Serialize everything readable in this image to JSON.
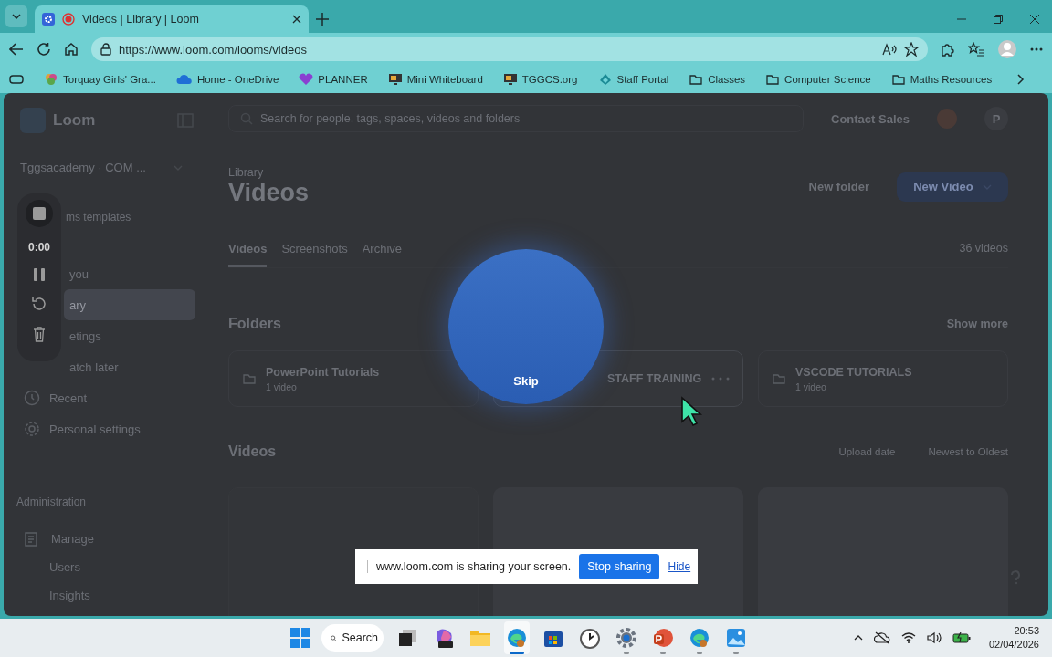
{
  "browser": {
    "tabs": [
      {
        "title": "Videos | Library | Loom",
        "selected": true
      }
    ],
    "url": "https://www.loom.com/looms/videos",
    "bookmarks": [
      {
        "label": "Torquay Girls' Gra...",
        "kind": "site"
      },
      {
        "label": "Home - OneDrive",
        "kind": "cloud"
      },
      {
        "label": "PLANNER",
        "kind": "planner"
      },
      {
        "label": "Mini Whiteboard",
        "kind": "screen"
      },
      {
        "label": "TGGCS.org",
        "kind": "screen"
      },
      {
        "label": "Staff Portal",
        "kind": "portal"
      },
      {
        "label": "Classes",
        "kind": "folder"
      },
      {
        "label": "Computer Science",
        "kind": "folder"
      },
      {
        "label": "Maths Resources",
        "kind": "folder"
      }
    ]
  },
  "sidebar": {
    "logo": "Loom",
    "workspace": "Tggsacademy · COM ...",
    "templates": "ms templates",
    "items": [
      {
        "label": "you",
        "kind": "clipped",
        "selected": false
      },
      {
        "label": "ary",
        "kind": "clipped",
        "selected": true
      },
      {
        "label": "etings",
        "kind": "clipped",
        "selected": false
      },
      {
        "label": "atch later",
        "kind": "clipped",
        "selected": false
      },
      {
        "label": "Recent",
        "kind": "recent",
        "selected": false
      },
      {
        "label": "Personal settings",
        "kind": "settings",
        "selected": false
      }
    ],
    "admin_heading": "Administration",
    "admin_items": [
      {
        "label": "Manage",
        "kind": "manage"
      },
      {
        "label": "Users",
        "kind": "sub"
      },
      {
        "label": "Insights",
        "kind": "sub"
      }
    ]
  },
  "header": {
    "search_placeholder": "Search for people, tags, spaces, videos and folders",
    "contact": "Contact Sales",
    "avatar": "P"
  },
  "main": {
    "breadcrumb": "Library",
    "title": "Videos",
    "new_folder": "New folder",
    "new_video": "New Video",
    "tabs": [
      {
        "label": "Videos",
        "selected": true
      },
      {
        "label": "Screenshots",
        "selected": false
      },
      {
        "label": "Archive",
        "selected": false
      }
    ],
    "count": "36 videos",
    "folders_heading": "Folders",
    "show_more": "Show more",
    "folders": [
      {
        "name": "PowerPoint Tutorials",
        "meta": "1 video",
        "hovered": false
      },
      {
        "name": "STAFF TRAINING",
        "hovered": true
      },
      {
        "name": "VSCODE TUTORIALS",
        "meta": "1 video",
        "hovered": false
      }
    ],
    "videos_heading": "Videos",
    "sort_field": "Upload date",
    "sort_order": "Newest to Oldest"
  },
  "recorder": {
    "time": "0:00"
  },
  "skip": "Skip",
  "share_bar": {
    "message": "www.loom.com is sharing your screen.",
    "stop": "Stop sharing",
    "hide": "Hide"
  },
  "taskbar": {
    "search": "Search",
    "apps": [
      {
        "kind": "taskview",
        "running": false,
        "selected": false
      },
      {
        "kind": "m365",
        "running": false,
        "selected": false
      },
      {
        "kind": "explorer",
        "running": false,
        "selected": false
      },
      {
        "kind": "edge",
        "running": true,
        "selected": true
      },
      {
        "kind": "store",
        "running": false,
        "selected": false
      },
      {
        "kind": "clock",
        "running": false,
        "selected": false
      },
      {
        "kind": "settings",
        "running": true,
        "selected": false
      },
      {
        "kind": "powerpoint",
        "running": true,
        "selected": false
      },
      {
        "kind": "edge",
        "running": true,
        "selected": false
      },
      {
        "kind": "photos",
        "running": true,
        "selected": false
      }
    ],
    "time": "20:53",
    "date": "02/04/2026"
  }
}
